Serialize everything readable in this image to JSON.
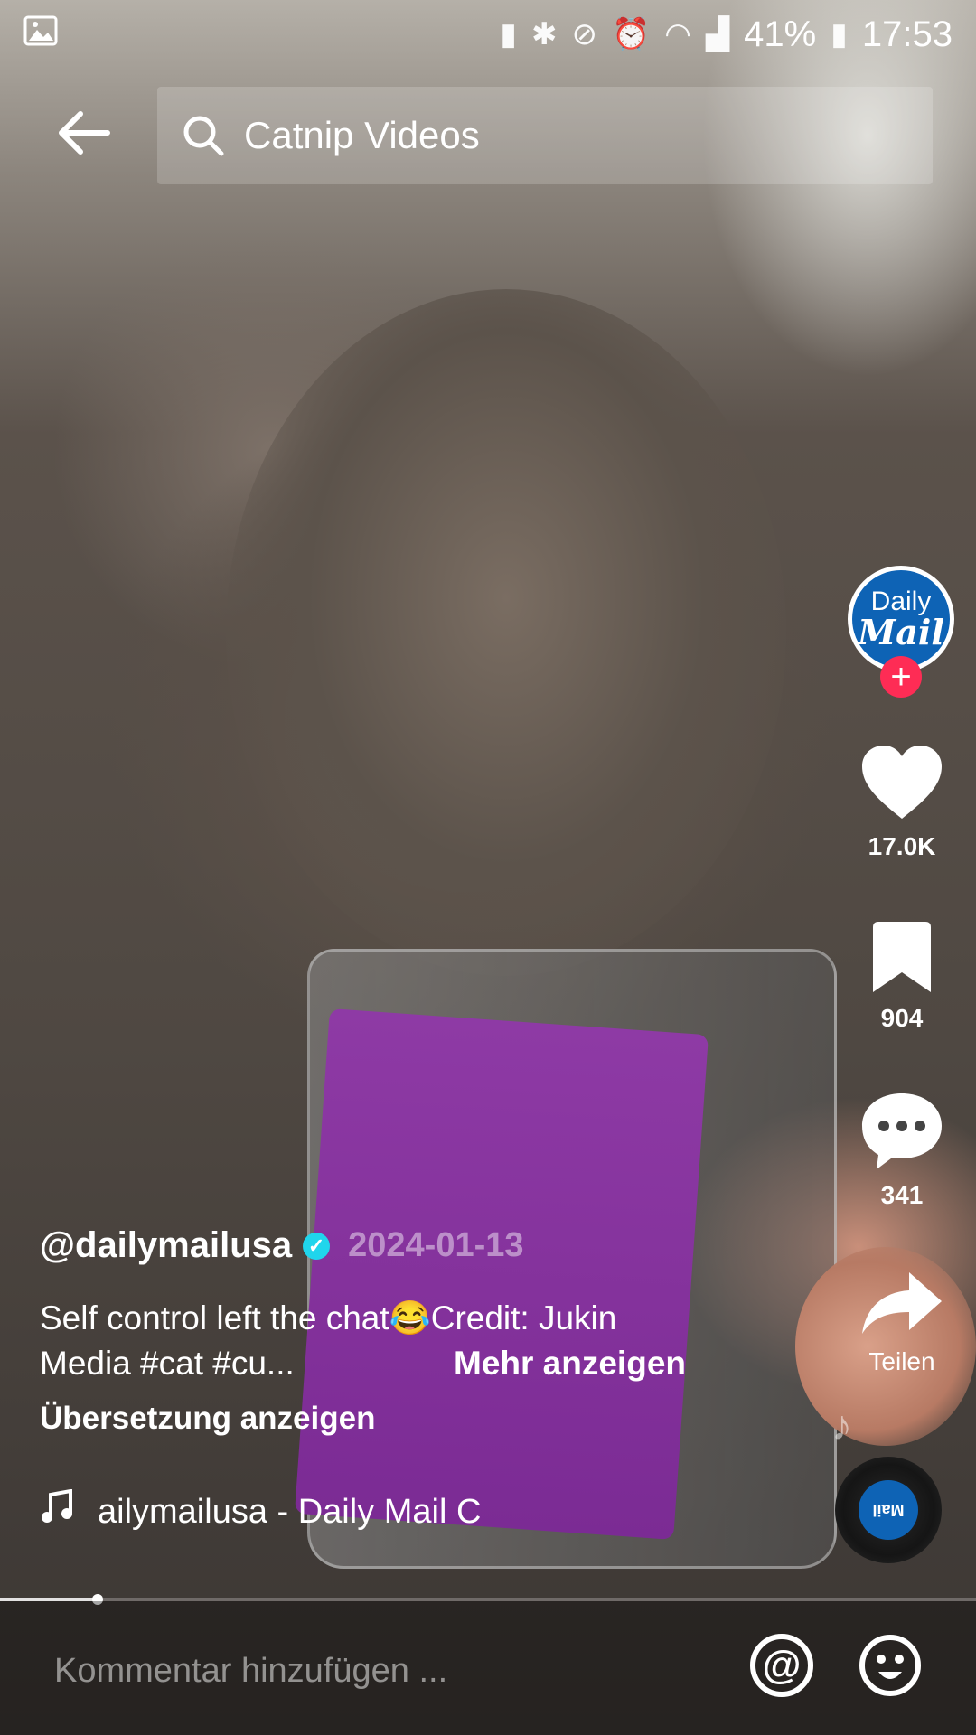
{
  "status_bar": {
    "battery": "41%",
    "time": "17:53"
  },
  "search": {
    "query": "Catnip Videos"
  },
  "creator": {
    "avatar_line1": "Daily",
    "avatar_line2": "Mail",
    "follow_symbol": "+"
  },
  "actions": {
    "likes": "17.0K",
    "saves": "904",
    "comments": "341",
    "share_label": "Teilen"
  },
  "post": {
    "username": "@dailymailusa",
    "date": "2024-01-13",
    "caption_line1": "Self control left the chat😂Credit: Jukin",
    "caption_line2": "Media #cat #cu...",
    "more_label": "Mehr anzeigen",
    "translate_label": "Übersetzung anzeigen",
    "music": "ailymailusa - Daily Mail    C"
  },
  "comment": {
    "placeholder": "Kommentar hinzufügen ..."
  },
  "progress": 0.1,
  "colors": {
    "follow": "#fe2c55",
    "verified": "#20d5ec",
    "brand": "#0e63b5"
  }
}
